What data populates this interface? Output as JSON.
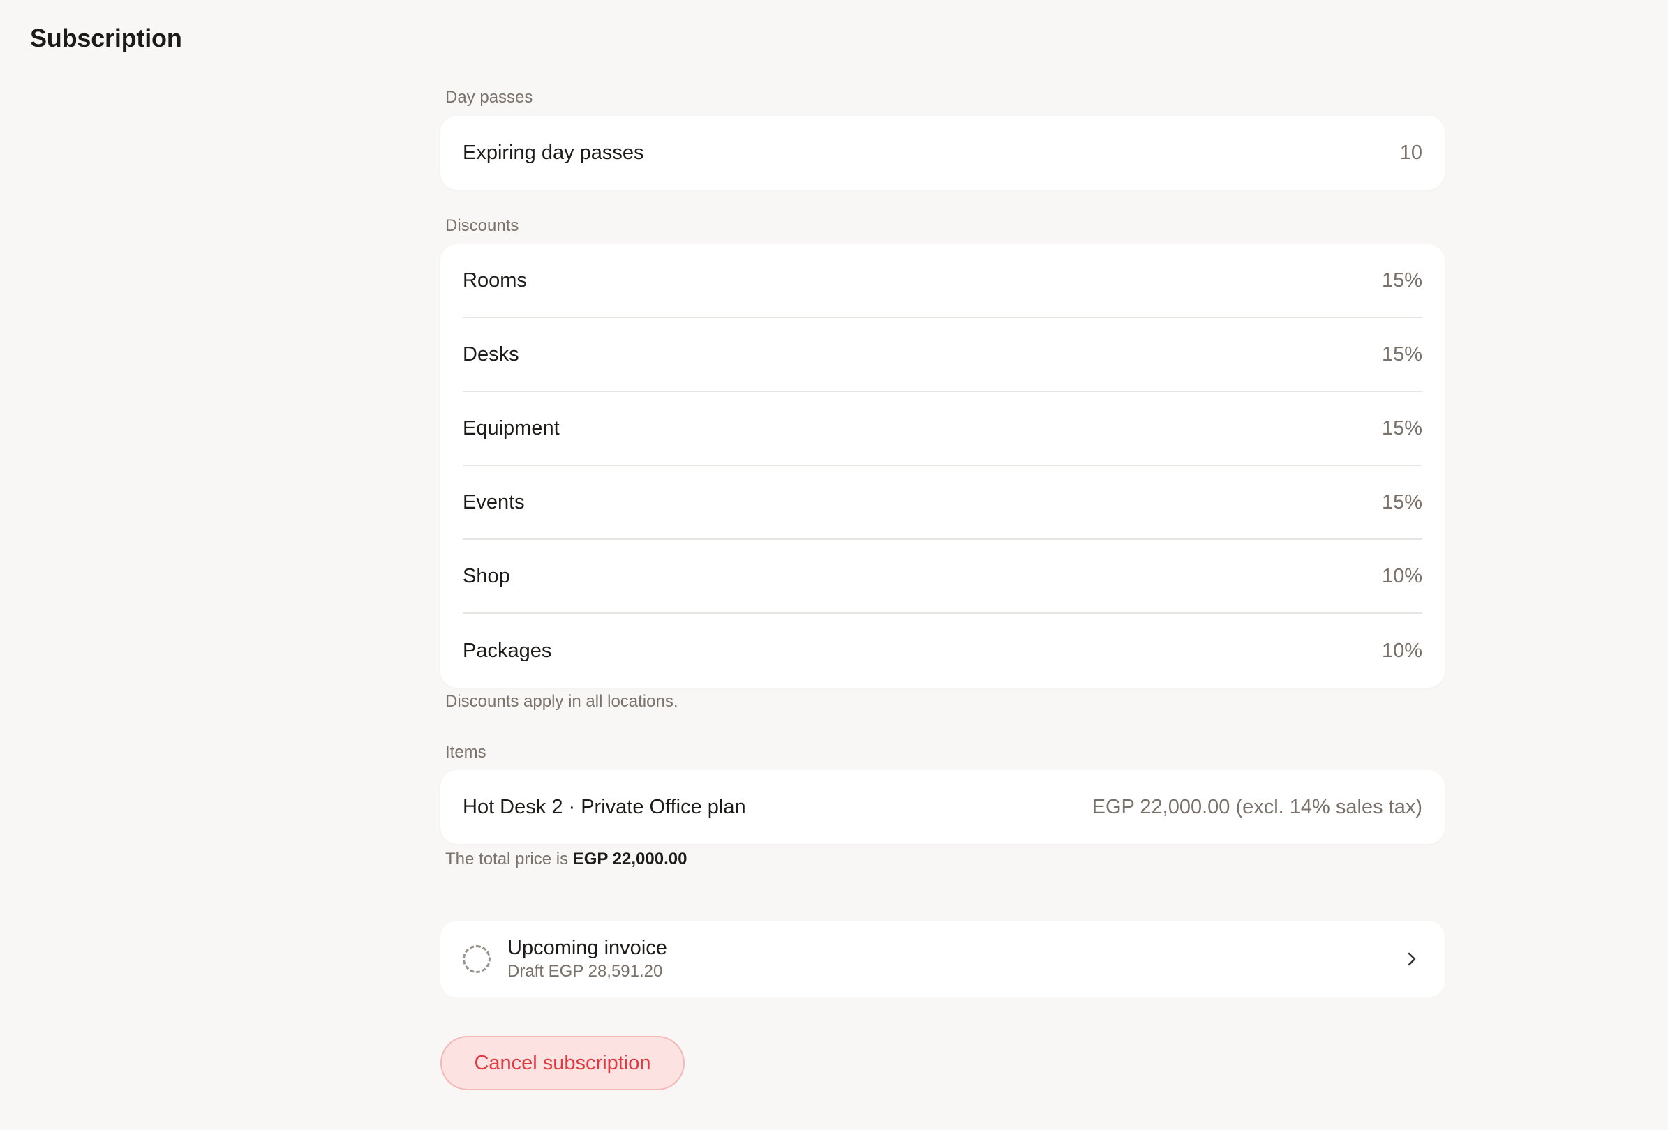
{
  "page": {
    "title": "Subscription"
  },
  "day_passes": {
    "label": "Day passes",
    "items": [
      {
        "label": "Expiring day passes",
        "value": "10"
      }
    ]
  },
  "discounts": {
    "label": "Discounts",
    "items": [
      {
        "label": "Rooms",
        "value": "15%"
      },
      {
        "label": "Desks",
        "value": "15%"
      },
      {
        "label": "Equipment",
        "value": "15%"
      },
      {
        "label": "Events",
        "value": "15%"
      },
      {
        "label": "Shop",
        "value": "10%"
      },
      {
        "label": "Packages",
        "value": "10%"
      }
    ],
    "note": "Discounts apply in all locations."
  },
  "items": {
    "label": "Items",
    "rows": [
      {
        "label": "Hot Desk 2 · Private Office plan",
        "value": "EGP 22,000.00 (excl. 14% sales tax)"
      }
    ],
    "total_prefix": "The total price is",
    "total_value": "EGP 22,000.00"
  },
  "invoice": {
    "title": "Upcoming invoice",
    "subtitle": "Draft EGP 28,591.20",
    "icon": "dashed-circle-icon"
  },
  "actions": {
    "cancel_label": "Cancel subscription"
  },
  "colors": {
    "background": "#f8f7f5",
    "card": "#ffffff",
    "muted_text": "#7a726a",
    "danger": "#e0393f",
    "danger_bg": "#fde2e2"
  }
}
